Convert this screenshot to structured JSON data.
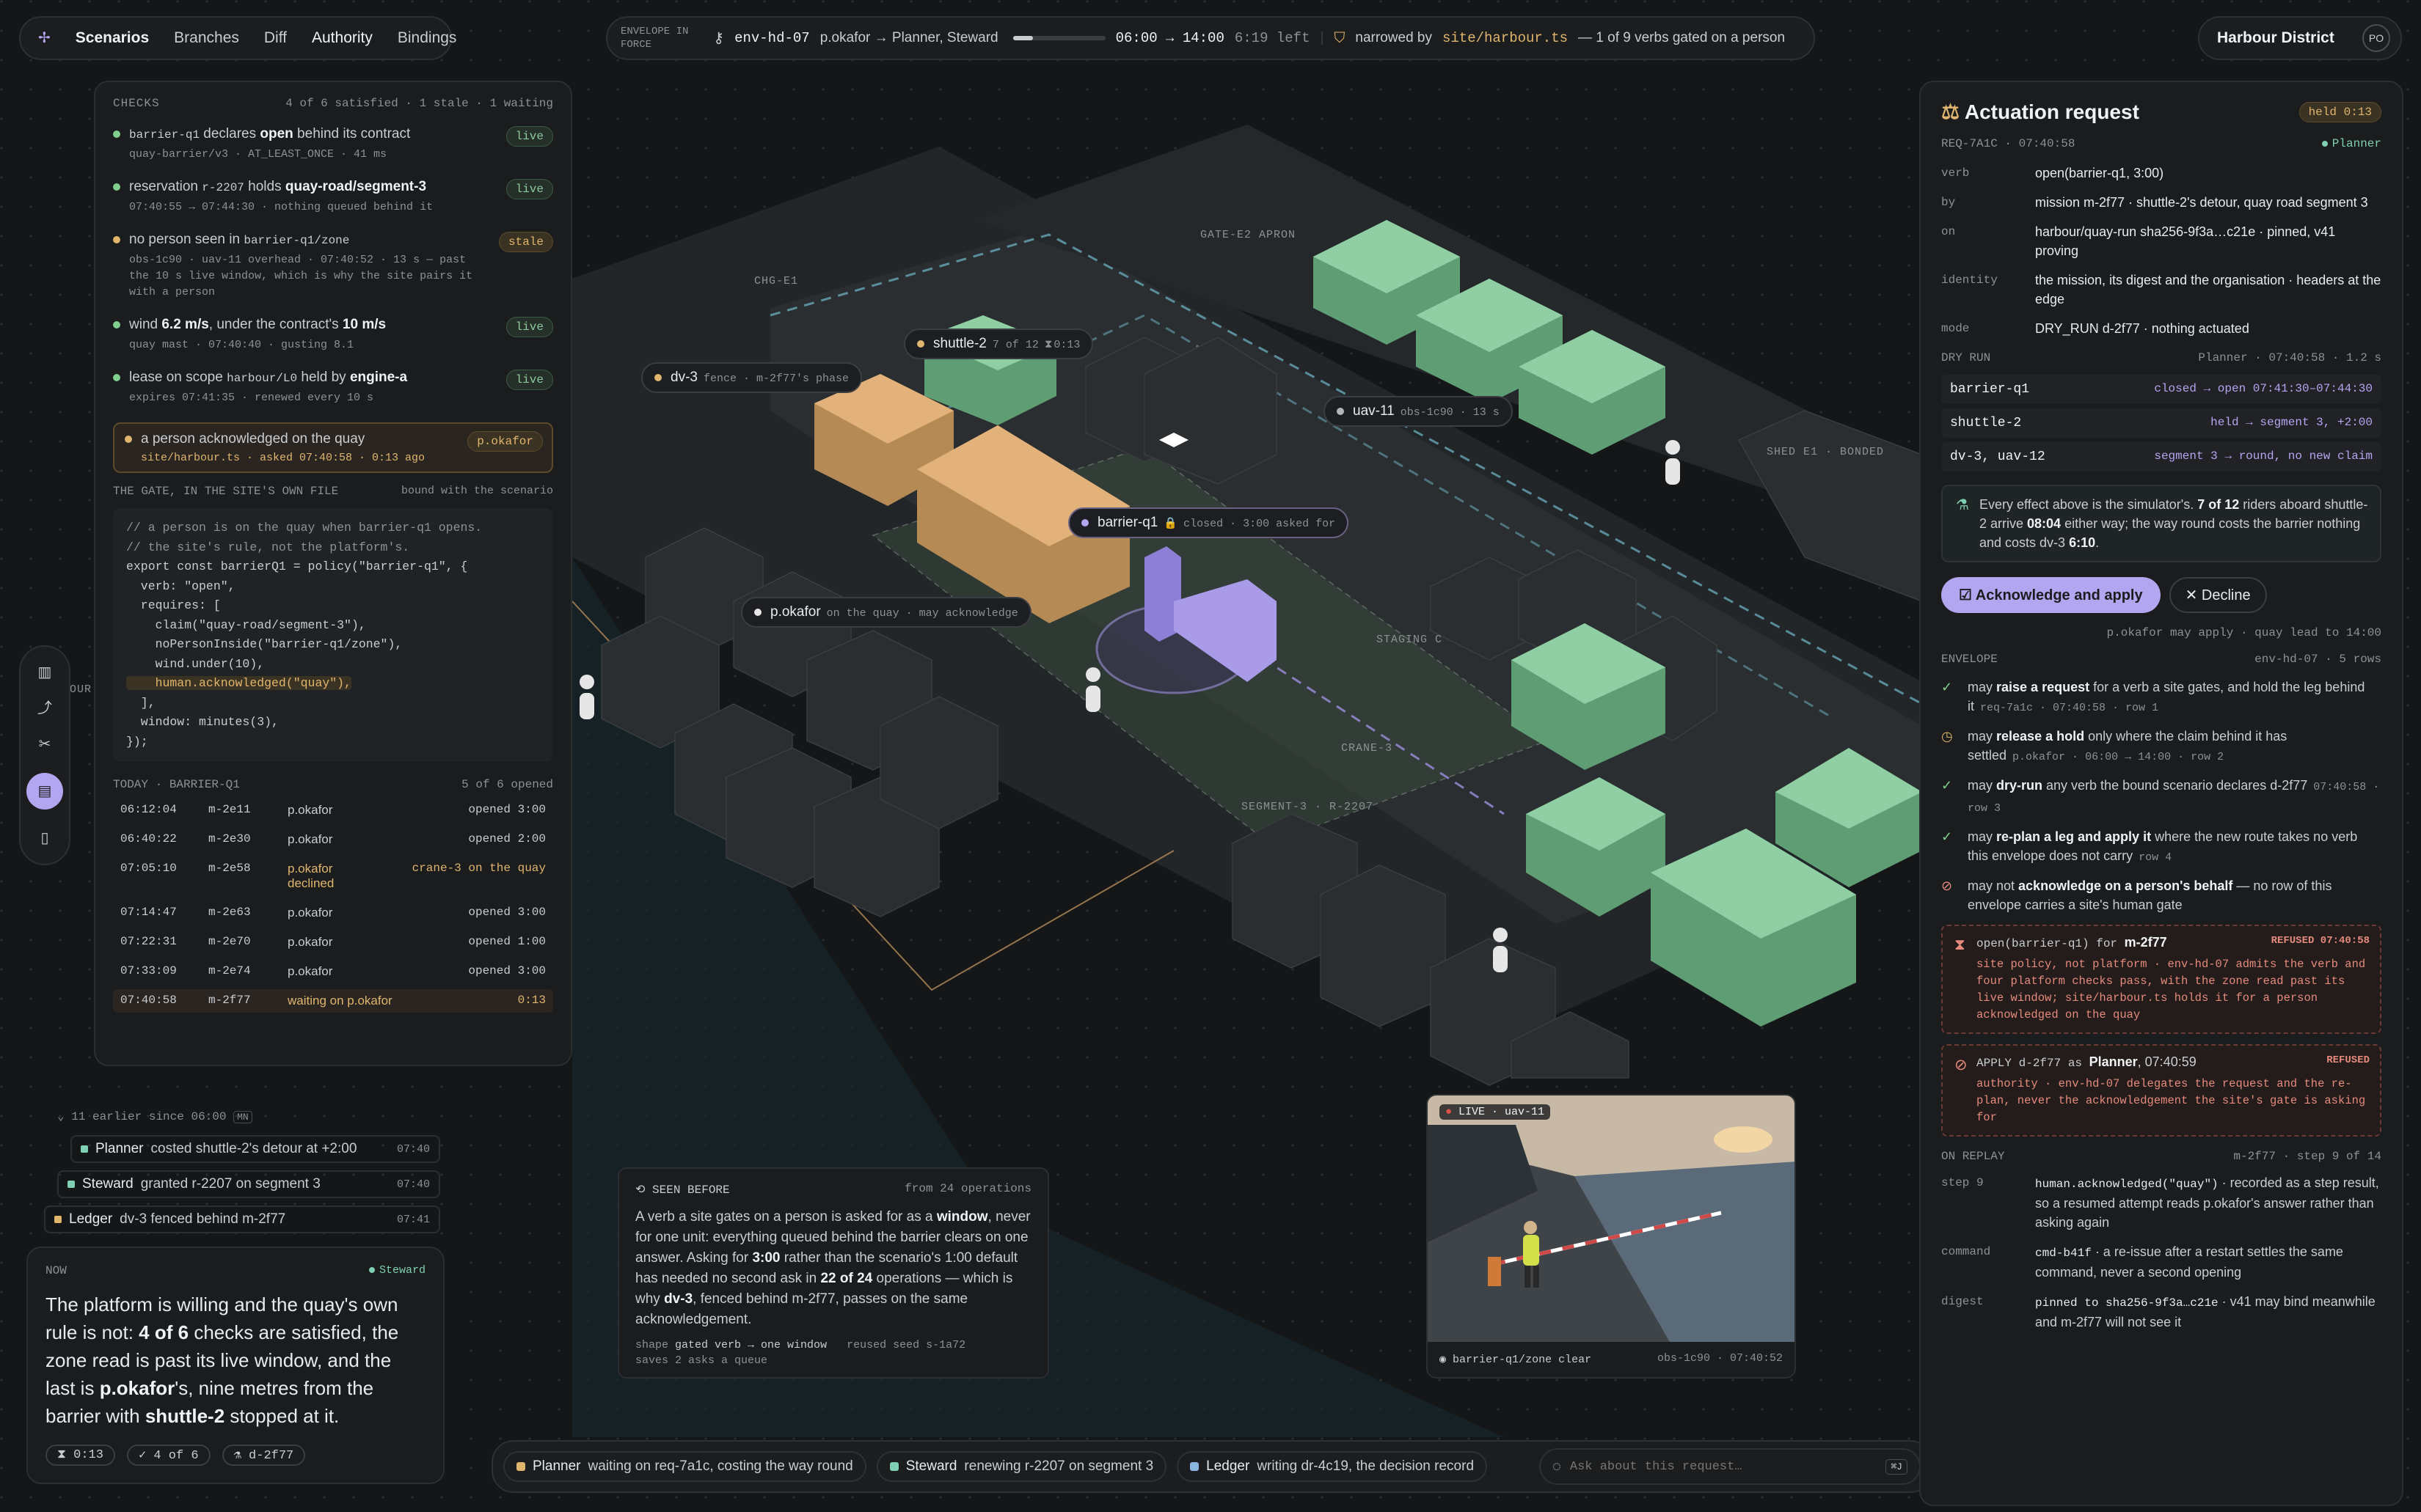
{
  "nav": {
    "tabs": [
      "Scenarios",
      "Branches",
      "Diff",
      "Authority",
      "Bindings"
    ]
  },
  "envelope": {
    "label1": "ENVELOPE IN",
    "label2": "FORCE",
    "id": "env-hd-07",
    "delegation": "p.okafor → Planner, Steward",
    "window": "06:00 → 14:00",
    "left": "6:19 left",
    "progress": 0.22,
    "narrowed_prefix": "narrowed by",
    "narrowed_file": "site/harbour.ts",
    "narrowed_suffix": "— 1 of 9 verbs gated on a person"
  },
  "org": {
    "name": "Harbour District",
    "initials": "PO"
  },
  "checks": {
    "title": "CHECKS",
    "summary": "4 of 6 satisfied · 1 stale · 1 waiting",
    "items": [
      {
        "pre": "barrier-q1",
        "mid": " declares ",
        "bold": "open",
        "post": " behind its contract",
        "meta": "quay-barrier/v3 · AT_LEAST_ONCE · 41 ms",
        "badge": "live"
      },
      {
        "pre": "reservation ",
        "code": "r-2207",
        "mid": " holds ",
        "bold": "quay-road/segment-3",
        "meta": "07:40:55 → 07:44:30 · nothing queued behind it",
        "badge": "live"
      },
      {
        "pre": "no person seen in ",
        "code": "barrier-q1/zone",
        "meta": "obs-1c90 · uav-11 overhead · 07:40:52 · 13 s — past the 10 s live window, which is why the site pairs it with a person",
        "badge": "stale"
      },
      {
        "pre": "wind ",
        "bold": "6.2 m/s",
        "mid": ", under the contract's ",
        "bold2": "10 m/s",
        "meta": "quay mast · 07:40:40 · gusting 8.1",
        "badge": "live"
      },
      {
        "pre": "lease on scope ",
        "code": "harbour/L0",
        "mid": " held by ",
        "bold": "engine-a",
        "meta": "expires 07:41:35 · renewed every 10 s",
        "badge": "live"
      }
    ],
    "waiting": {
      "text": "a person acknowledged on the quay",
      "meta": "site/harbour.ts · asked 07:40:58 · 0:13 ago",
      "badge": "p.okafor"
    }
  },
  "gate": {
    "title": "THE GATE, IN THE SITE'S OWN FILE",
    "sub": "bound with the scenario",
    "code": [
      "// a person is on the quay when barrier-q1 opens.",
      "// the site's rule, not the platform's.",
      "export const barrierQ1 = policy(\"barrier-q1\", {",
      "  verb: \"open\",",
      "  requires: [",
      "    claim(\"quay-road/segment-3\"),",
      "    noPersonInside(\"barrier-q1/zone\"),",
      "    wind.under(10),",
      "    human.acknowledged(\"quay\"),",
      "  ],",
      "  window: minutes(3),",
      "});"
    ]
  },
  "today": {
    "title": "TODAY · BARRIER-Q1",
    "summary": "5 of 6 opened",
    "rows": [
      {
        "t": "06:12:04",
        "m": "m-2e11",
        "who": "p.okafor",
        "res": "opened 3:00"
      },
      {
        "t": "06:40:22",
        "m": "m-2e30",
        "who": "p.okafor",
        "res": "opened 2:00"
      },
      {
        "t": "07:05:10",
        "m": "m-2e58",
        "who": "p.okafor declined",
        "res": "crane-3 on the quay"
      },
      {
        "t": "07:14:47",
        "m": "m-2e63",
        "who": "p.okafor",
        "res": "opened 3:00"
      },
      {
        "t": "07:22:31",
        "m": "m-2e70",
        "who": "p.okafor",
        "res": "opened 1:00"
      },
      {
        "t": "07:33:09",
        "m": "m-2e74",
        "who": "p.okafor",
        "res": "opened 3:00"
      },
      {
        "t": "07:40:58",
        "m": "m-2f77",
        "who": "waiting on p.okafor",
        "res": "0:13"
      }
    ]
  },
  "feed": {
    "earlier": "11 earlier since 06:00",
    "earlier_key": "MN",
    "items": [
      {
        "who": "Planner",
        "text": "costed shuttle-2's detour at +2:00",
        "t": "07:40"
      },
      {
        "who": "Steward",
        "text": "granted r-2207 on segment 3",
        "t": "07:40"
      },
      {
        "who": "Ledger",
        "text": "dv-3 fenced behind m-2f77",
        "t": "07:41"
      }
    ]
  },
  "now": {
    "label": "NOW",
    "agent": "Steward",
    "p1": "The platform is willing and the quay's own rule is not: ",
    "b1": "4 of 6",
    "p2": " checks are satisfied, the zone read is past its live window, and the last is ",
    "b2": "p.okafor",
    "p3": "'s, nine metres from the barrier with ",
    "b3": "shuttle-2",
    "p4": " stopped at it.",
    "chips": [
      "0:13",
      "4 of 6",
      "d-2f77"
    ]
  },
  "map": {
    "labels": [
      "CHG-E1",
      "GATE-E2 APRON",
      "SHED E1 · BONDED",
      "STAGING C",
      "CRANE-3",
      "SEGMENT-3 · R-2207",
      "OUR"
    ],
    "tags": {
      "shuttle": {
        "name": "shuttle-2",
        "sub": "7 of 12",
        "sub2": "0:13"
      },
      "dv3": {
        "name": "dv-3",
        "sub": "fence · m-2f77's phase"
      },
      "uav": {
        "name": "uav-11",
        "sub": "obs-1c90 · 13 s"
      },
      "barrier": {
        "name": "barrier-q1",
        "sub": "closed · 3:00 asked for"
      },
      "person": {
        "name": "p.okafor",
        "sub": "on the quay · may acknowledge"
      }
    }
  },
  "seen": {
    "title": "SEEN BEFORE",
    "from": "from 24 operations",
    "p1": "A verb a site gates on a person is asked for as a ",
    "b1": "window",
    "p2": ", never for one unit: everything queued behind the barrier clears on one answer. Asking for ",
    "b2": "3:00",
    "p3": " rather than the scenario's 1:00 default has needed no second ask in ",
    "b3": "22 of 24",
    "p4": " operations — which is why ",
    "b4": "dv-3",
    "p5": ", fenced behind m-2f77, passes on the same acknowledgement.",
    "shape_k": "shape",
    "shape_v": "gated verb → one window",
    "reused": "reused seed s-1a72",
    "saves": "saves 2 asks a queue"
  },
  "camera": {
    "live": "LIVE · uav-11",
    "zone": "barrier-q1/zone clear",
    "obs": "obs-1c90 · 07:40:52"
  },
  "agents": [
    {
      "who": "Planner",
      "text": "waiting on req-7a1c, costing the way round",
      "color": "#e0b56d"
    },
    {
      "who": "Steward",
      "text": "renewing r-2207 on segment 3",
      "color": "#7fcfb3"
    },
    {
      "who": "Ledger",
      "text": "writing dr-4c19, the decision record",
      "color": "#8ab7e0"
    }
  ],
  "ask": {
    "placeholder": "Ask about this request…",
    "key": "⌘J"
  },
  "request": {
    "title": "Actuation request",
    "held": "held 0:13",
    "id": "REQ-7A1C · 07:40:58",
    "agent": "Planner",
    "fields": [
      {
        "k": "verb",
        "v": "open(barrier-q1, 3:00)"
      },
      {
        "k": "by",
        "v": "mission m-2f77 · shuttle-2's detour, quay road segment 3"
      },
      {
        "k": "on",
        "v": "harbour/quay-run sha256-9f3a…c21e · pinned, v41 proving"
      },
      {
        "k": "identity",
        "v": "the mission, its digest and the organisation · headers at the edge"
      },
      {
        "k": "mode",
        "v": "DRY_RUN d-2f77 · nothing actuated"
      }
    ],
    "dry": {
      "title": "DRY RUN",
      "meta": "Planner · 07:40:58 · 1.2 s",
      "rows": [
        {
          "a": "barrier-q1",
          "b": "closed → open 07:41:30–07:44:30"
        },
        {
          "a": "shuttle-2",
          "b": "held → segment 3, +2:00"
        },
        {
          "a": "dv-3, uav-12",
          "b": "segment 3 → round, no new claim"
        }
      ],
      "note_p1": "Every effect above is the simulator's. ",
      "note_b1": "7 of 12",
      "note_p2": " riders aboard shuttle-2 arrive ",
      "note_b2": "08:04",
      "note_p3": " either way; the way round costs the barrier nothing and costs dv-3 ",
      "note_b3": "6:10",
      "note_p4": "."
    },
    "ack_button": "Acknowledge and apply",
    "decline_button": "Decline",
    "may_apply": "p.okafor may apply · quay lead to 14:00"
  },
  "env_rows": {
    "title": "ENVELOPE",
    "meta": "env-hd-07 · 5 rows",
    "rows": [
      {
        "kind": "ok",
        "pre": "may ",
        "b": "raise a request",
        "post": " for a verb a site gates, and hold the leg behind it",
        "meta": "req-7a1c · 07:40:58 · row 1"
      },
      {
        "kind": "warn",
        "pre": "may ",
        "b": "release a hold",
        "post": " only where the claim behind it has settled",
        "meta": "p.okafor · 06:00 → 14:00 · row 2"
      },
      {
        "kind": "ok",
        "pre": "may ",
        "b": "dry-run",
        "post": " any verb the bound scenario declares d-2f77",
        "meta": "07:40:58 · row 3"
      },
      {
        "kind": "ok",
        "pre": "may ",
        "b": "re-plan a leg and apply it",
        "post": " where the new route takes no verb this envelope does not carry",
        "meta": "row 4"
      },
      {
        "kind": "no",
        "pre": "may not ",
        "b": "acknowledge on a person's behalf",
        "post": " — no row of this envelope carries a site's human gate",
        "meta": ""
      }
    ]
  },
  "refusals": [
    {
      "head_pre": "open(barrier-q1) for ",
      "head_b": "m-2f77",
      "tag": "REFUSED 07:40:58",
      "body": "site policy, not platform · env-hd-07 admits the verb and four platform checks pass, with the zone read past its live window; site/harbour.ts holds it for a person acknowledged on the quay"
    },
    {
      "head_pre": "APPLY d-2f77 as ",
      "head_b": "Planner",
      "head_post": ", 07:40:59",
      "tag": "REFUSED",
      "body": "authority · env-hd-07 delegates the request and the re-plan, never the acknowledgement the site's gate is asking for"
    }
  ],
  "replay": {
    "title": "ON REPLAY",
    "meta": "m-2f77 · step 9 of 14",
    "rows": [
      {
        "k": "step 9",
        "code": "human.acknowledged(\"quay\")",
        "v": " · recorded as a step result, so a resumed attempt reads p.okafor's answer rather than asking again"
      },
      {
        "k": "command",
        "code": "cmd-b41f",
        "v": " · a re-issue after a restart settles the same command, never a second opening"
      },
      {
        "k": "digest",
        "code": "pinned to sha256-9f3a…c21e",
        "v": " · v41 may bind meanwhile and m-2f77 will not see it"
      }
    ]
  },
  "colors": {
    "accent": "#b3a6f0",
    "live": "#7fd08f",
    "stale": "#e0b56d",
    "refused": "#e58a7c",
    "building_green": "#8fcfa3",
    "building_tan": "#e3b27a"
  }
}
